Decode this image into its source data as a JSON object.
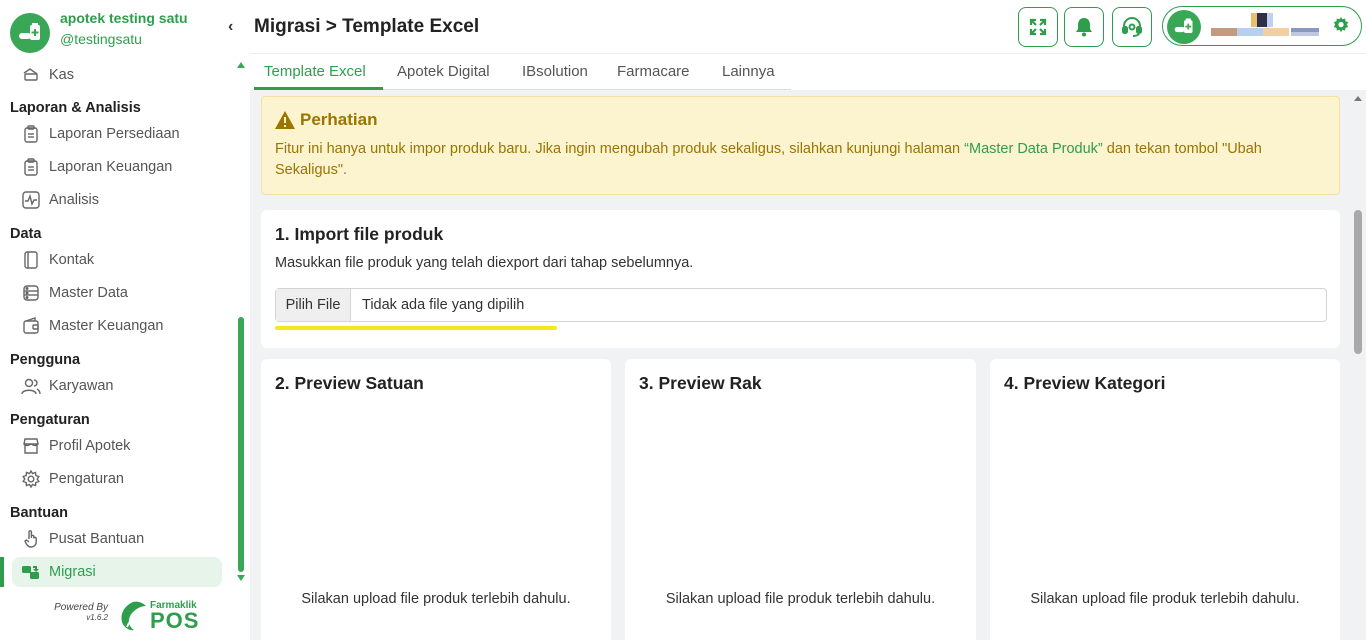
{
  "sidebar": {
    "store_name": "apotek testing satu",
    "store_handle": "@testingsatu",
    "collapse_icon": "‹",
    "items": [
      {
        "label": "Kas"
      },
      {
        "heading": "Laporan & Analisis"
      },
      {
        "label": "Laporan Persediaan"
      },
      {
        "label": "Laporan Keuangan"
      },
      {
        "label": "Analisis"
      },
      {
        "heading": "Data"
      },
      {
        "label": "Kontak"
      },
      {
        "label": "Master Data"
      },
      {
        "label": "Master Keuangan"
      },
      {
        "heading": "Pengguna"
      },
      {
        "label": "Karyawan"
      },
      {
        "heading": "Pengaturan"
      },
      {
        "label": "Profil Apotek"
      },
      {
        "label": "Pengaturan"
      },
      {
        "heading": "Bantuan"
      },
      {
        "label": "Pusat Bantuan"
      },
      {
        "label": "Migrasi",
        "active": true
      }
    ],
    "powered_by": "Powered By",
    "version": "v1.6.2",
    "pos_brand_small": "Farmaklik",
    "pos_brand_big": "POS"
  },
  "header": {
    "title": "Migrasi > Template Excel"
  },
  "tabs": [
    {
      "label": "Template Excel",
      "active": true
    },
    {
      "label": "Apotek Digital"
    },
    {
      "label": "IBsolution"
    },
    {
      "label": "Farmacare"
    },
    {
      "label": "Lainnya"
    }
  ],
  "alert": {
    "title": "Perhatian",
    "text_before": "Fitur ini hanya untuk impor produk baru. Jika ingin mengubah produk sekaligus, silahkan kunjungi halaman ",
    "link": "“Master Data Produk”",
    "text_after": " dan tekan tombol \"Ubah Sekaligus\"."
  },
  "import": {
    "title": "1. Import file produk",
    "subtitle": "Masukkan file produk yang telah diexport dari tahap sebelumnya.",
    "button": "Pilih File",
    "file_status": "Tidak ada file yang dipilih"
  },
  "previews": [
    {
      "title": "2. Preview Satuan",
      "empty": "Silakan upload file produk terlebih dahulu."
    },
    {
      "title": "3. Preview Rak",
      "empty": "Silakan upload file produk terlebih dahulu."
    },
    {
      "title": "4. Preview Kategori",
      "empty": "Silakan upload file produk terlebih dahulu."
    }
  ],
  "colors": {
    "brand": "#2e9e4d",
    "alert_bg": "#fcf3cf",
    "alert_text": "#9a7500",
    "highlight": "#f6e61e"
  }
}
